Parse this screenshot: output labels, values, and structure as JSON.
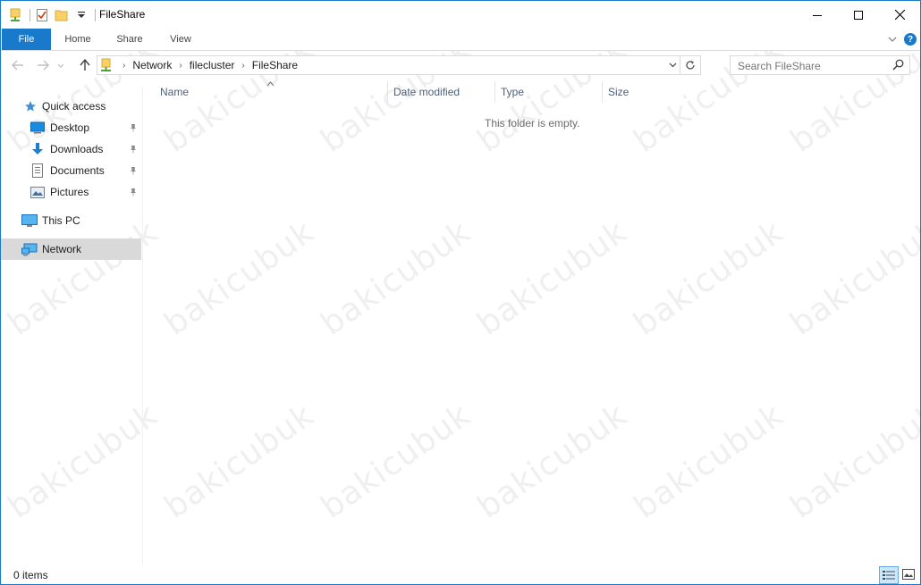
{
  "window": {
    "title": "FileShare",
    "accent_color": "#1979ca"
  },
  "quick_access_toolbar": {
    "icons": [
      "folder-network-icon",
      "properties-checkmark-icon",
      "new-folder-icon",
      "customize-dropdown-icon"
    ]
  },
  "ribbon": {
    "tabs": [
      {
        "label": "File",
        "active": true
      },
      {
        "label": "Home"
      },
      {
        "label": "Share"
      },
      {
        "label": "View"
      }
    ],
    "help_label": "?"
  },
  "navigation": {
    "breadcrumb": [
      "Network",
      "filecluster",
      "FileShare"
    ],
    "search_placeholder": "Search FileShare"
  },
  "nav_pane": {
    "quick_access": {
      "label": "Quick access",
      "icon": "star-icon"
    },
    "pinned_items": [
      {
        "label": "Desktop",
        "icon": "desktop-icon",
        "pinned": true
      },
      {
        "label": "Downloads",
        "icon": "download-arrow-icon",
        "pinned": true
      },
      {
        "label": "Documents",
        "icon": "document-icon",
        "pinned": true
      },
      {
        "label": "Pictures",
        "icon": "pictures-icon",
        "pinned": true
      }
    ],
    "this_pc": {
      "label": "This PC",
      "icon": "monitor-icon"
    },
    "network": {
      "label": "Network",
      "icon": "network-icon",
      "selected": true
    }
  },
  "file_list": {
    "columns": [
      "Name",
      "Date modified",
      "Type",
      "Size"
    ],
    "sorted_by": "Name",
    "empty_message": "This folder is empty."
  },
  "status_bar": {
    "item_count": "0 items",
    "view_mode": "details"
  },
  "watermark_text": "bakicubuk"
}
